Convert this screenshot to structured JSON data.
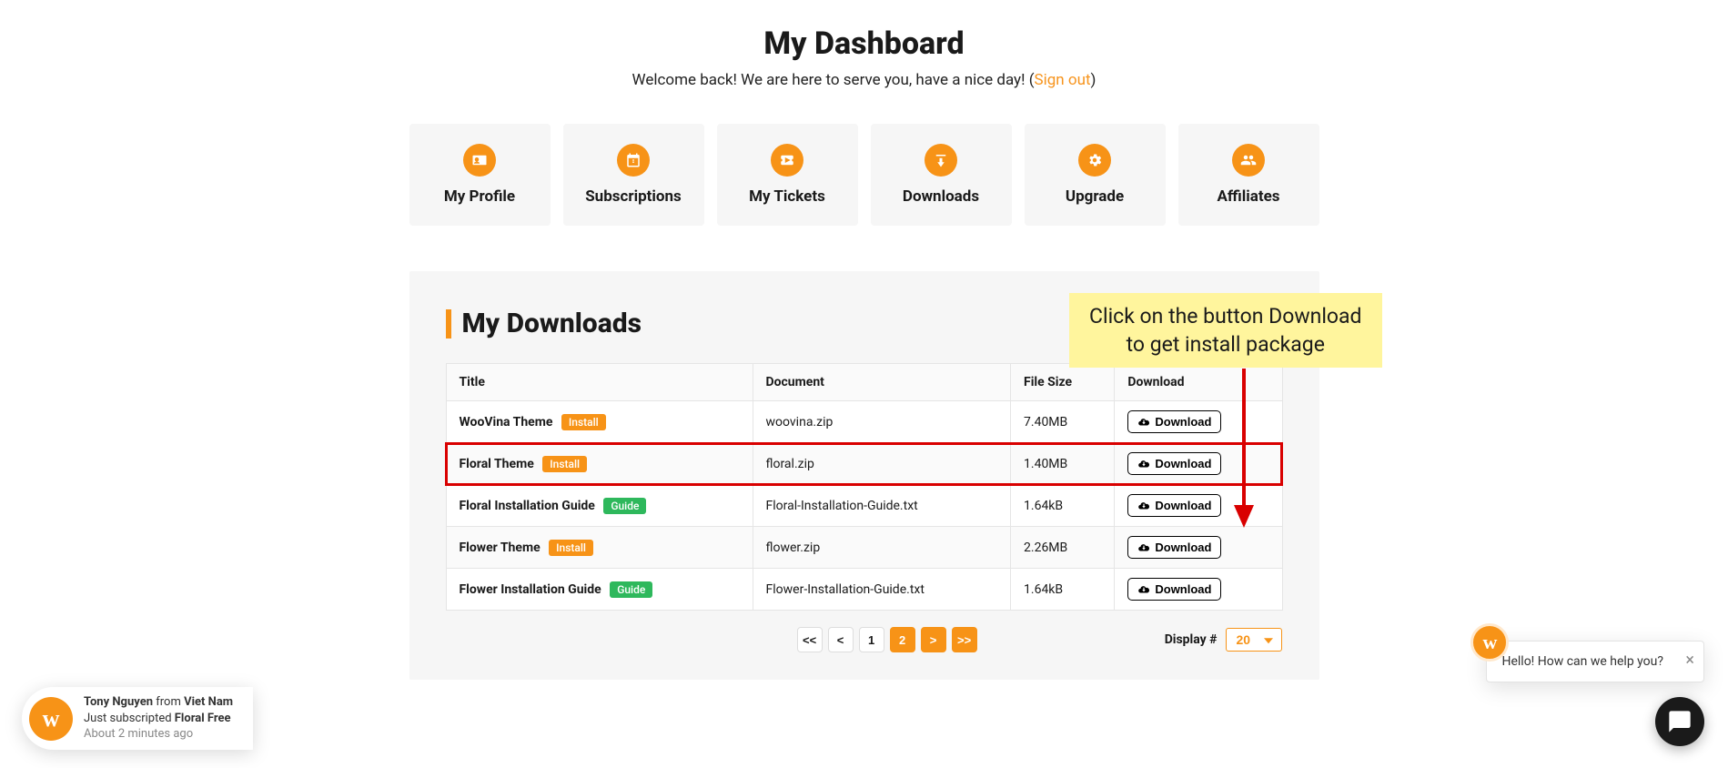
{
  "page": {
    "title": "My Dashboard",
    "welcome_prefix": "Welcome back! We are here to serve you, have a nice day! (",
    "signout": "Sign out",
    "welcome_suffix": ")"
  },
  "tiles": [
    {
      "label": "My Profile",
      "icon": "profile-icon"
    },
    {
      "label": "Subscriptions",
      "icon": "calendar-icon"
    },
    {
      "label": "My Tickets",
      "icon": "ticket-icon"
    },
    {
      "label": "Downloads",
      "icon": "download-icon"
    },
    {
      "label": "Upgrade",
      "icon": "gear-icon"
    },
    {
      "label": "Affiliates",
      "icon": "group-icon"
    }
  ],
  "callout": {
    "line1": "Click on the button Download",
    "line2": "to get install package"
  },
  "downloads": {
    "heading": "My Downloads",
    "columns": {
      "title": "Title",
      "document": "Document",
      "size": "File Size",
      "download": "Download"
    },
    "download_button_label": "Download",
    "rows": [
      {
        "title": "WooVina Theme",
        "badge": "Install",
        "badge_type": "install",
        "document": "woovina.zip",
        "size": "7.40MB",
        "highlight": false
      },
      {
        "title": "Floral Theme",
        "badge": "Install",
        "badge_type": "install",
        "document": "floral.zip",
        "size": "1.40MB",
        "highlight": true
      },
      {
        "title": "Floral Installation Guide",
        "badge": "Guide",
        "badge_type": "guide",
        "document": "Floral-Installation-Guide.txt",
        "size": "1.64kB",
        "highlight": false
      },
      {
        "title": "Flower Theme",
        "badge": "Install",
        "badge_type": "install",
        "document": "flower.zip",
        "size": "2.26MB",
        "highlight": false
      },
      {
        "title": "Flower Installation Guide",
        "badge": "Guide",
        "badge_type": "guide",
        "document": "Flower-Installation-Guide.txt",
        "size": "1.64kB",
        "highlight": false
      }
    ]
  },
  "pager": {
    "first": "<<",
    "prev": "<",
    "pages": [
      "1",
      "2"
    ],
    "active": "2",
    "next": ">",
    "last": ">>",
    "display_label": "Display #",
    "display_value": "20"
  },
  "toast": {
    "avatar_letter": "w",
    "name": "Tony Nguyen",
    "from_word": " from ",
    "country": "Viet Nam",
    "action_prefix": "Just subscripted ",
    "action_bold": "Floral Free",
    "time": "About 2 minutes ago"
  },
  "chat": {
    "avatar_letter": "w",
    "message": "Hello! How can we help you?",
    "close": "×"
  },
  "colors": {
    "accent": "#f79317",
    "green": "#2eb85c",
    "red": "#d90000",
    "callout": "#fff59d"
  }
}
